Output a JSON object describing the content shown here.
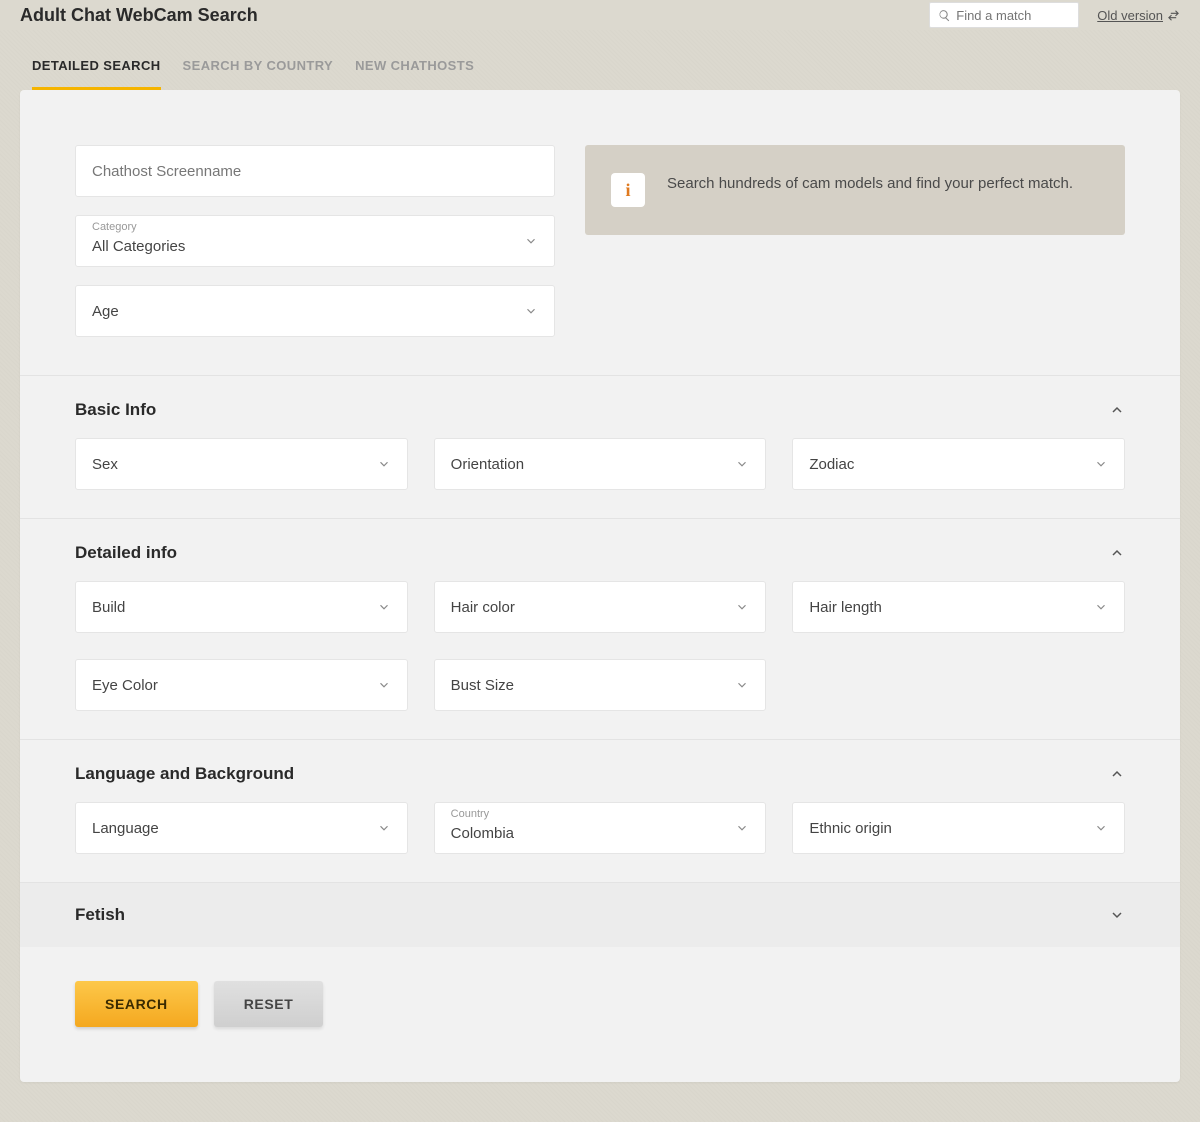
{
  "header": {
    "title": "Adult Chat WebCam Search",
    "search_placeholder": "Find a match",
    "old_version": "Old version"
  },
  "tabs": {
    "detailed": "DETAILED SEARCH",
    "country": "SEARCH BY COUNTRY",
    "new": "NEW CHATHOSTS"
  },
  "top": {
    "screenname_placeholder": "Chathost Screenname",
    "category_label": "Category",
    "category_value": "All Categories",
    "age_label": "Age"
  },
  "info": {
    "icon": "i",
    "text": "Search hundreds of cam models and find your perfect match."
  },
  "sections": {
    "basic": {
      "title": "Basic Info",
      "sex": "Sex",
      "orientation": "Orientation",
      "zodiac": "Zodiac"
    },
    "detailed": {
      "title": "Detailed info",
      "build": "Build",
      "hair_color": "Hair color",
      "hair_length": "Hair length",
      "eye_color": "Eye Color",
      "bust_size": "Bust Size"
    },
    "lang": {
      "title": "Language and Background",
      "language": "Language",
      "country_label": "Country",
      "country_value": "Colombia",
      "ethnic": "Ethnic origin"
    },
    "fetish": {
      "title": "Fetish"
    }
  },
  "actions": {
    "search": "SEARCH",
    "reset": "RESET"
  }
}
